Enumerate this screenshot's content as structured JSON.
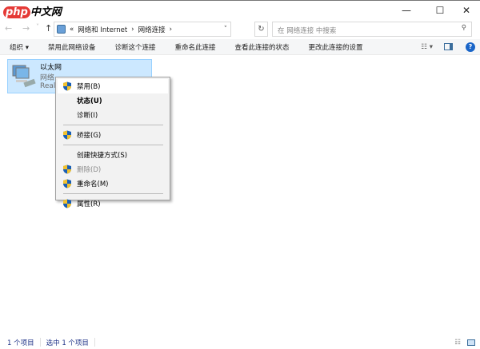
{
  "window": {
    "logo_text": "php中文网",
    "minimize": "—",
    "maximize": "☐",
    "close": "✕"
  },
  "address": {
    "back": "←",
    "forward": "→",
    "recent": "˅",
    "up": "↑",
    "crumbs": [
      "«",
      "网络和 Internet",
      "›",
      "网络连接",
      "›"
    ],
    "refresh": "↻",
    "search_placeholder": "在 网络连接 中搜索"
  },
  "toolbar": {
    "organize": "组织 ▾",
    "items": [
      "禁用此网络设备",
      "诊断这个连接",
      "重命名此连接",
      "查看此连接的状态",
      "更改此连接的设置"
    ]
  },
  "adapter": {
    "name": "以太网",
    "line2": "网络",
    "line3": "Real"
  },
  "context_menu": [
    {
      "label": "禁用(B)",
      "shield": true
    },
    {
      "label": "状态(U)",
      "bold": true
    },
    {
      "label": "诊断(I)"
    },
    {
      "sep": true
    },
    {
      "label": "桥接(G)",
      "shield": true
    },
    {
      "sep": true
    },
    {
      "label": "创建快捷方式(S)"
    },
    {
      "label": "删除(D)",
      "shield": true,
      "disabled": true
    },
    {
      "label": "重命名(M)",
      "shield": true
    },
    {
      "sep": true
    },
    {
      "label": "属性(R)",
      "shield": true
    }
  ],
  "status": {
    "count": "1 个项目",
    "selected": "选中 1 个项目"
  }
}
